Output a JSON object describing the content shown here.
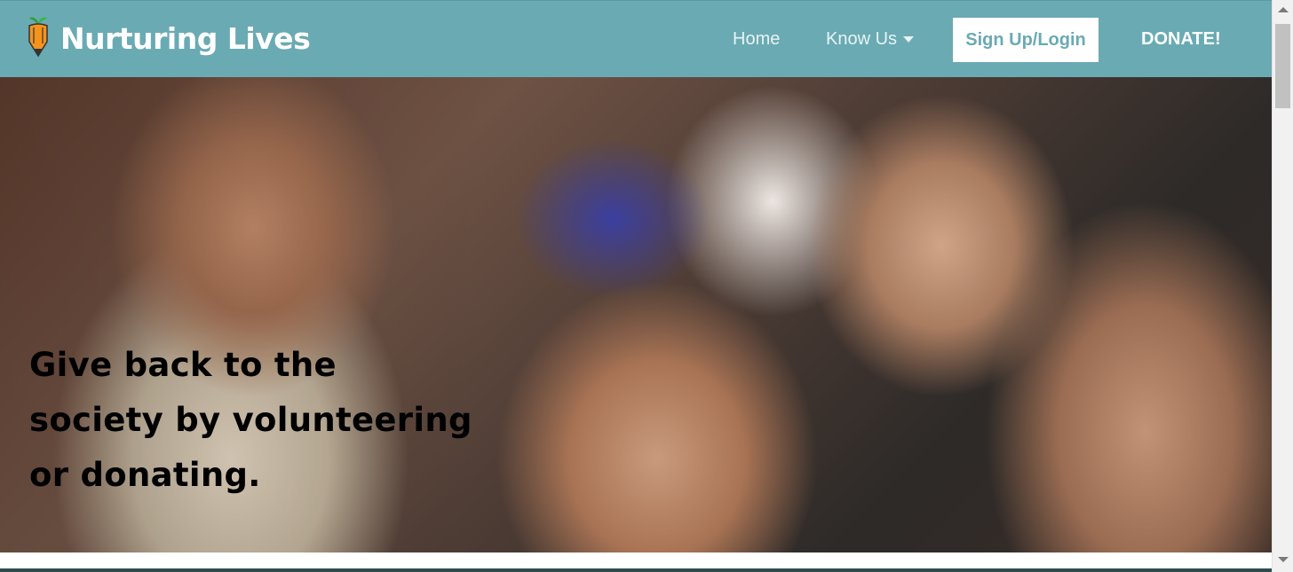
{
  "brand": {
    "name": "Nurturing Lives",
    "logo_icon": "carrot-pencil-icon"
  },
  "nav": {
    "home": "Home",
    "know_us": "Know Us",
    "signup": "Sign Up/Login",
    "donate": "DONATE!"
  },
  "hero": {
    "headline_line1": "Give back to the",
    "headline_line2": "society by volunteering",
    "headline_line3": "or donating."
  },
  "colors": {
    "navbar": "#6aaab3",
    "brand_text": "#ffffff",
    "signup_bg": "#ffffff",
    "headline": "#000000"
  }
}
